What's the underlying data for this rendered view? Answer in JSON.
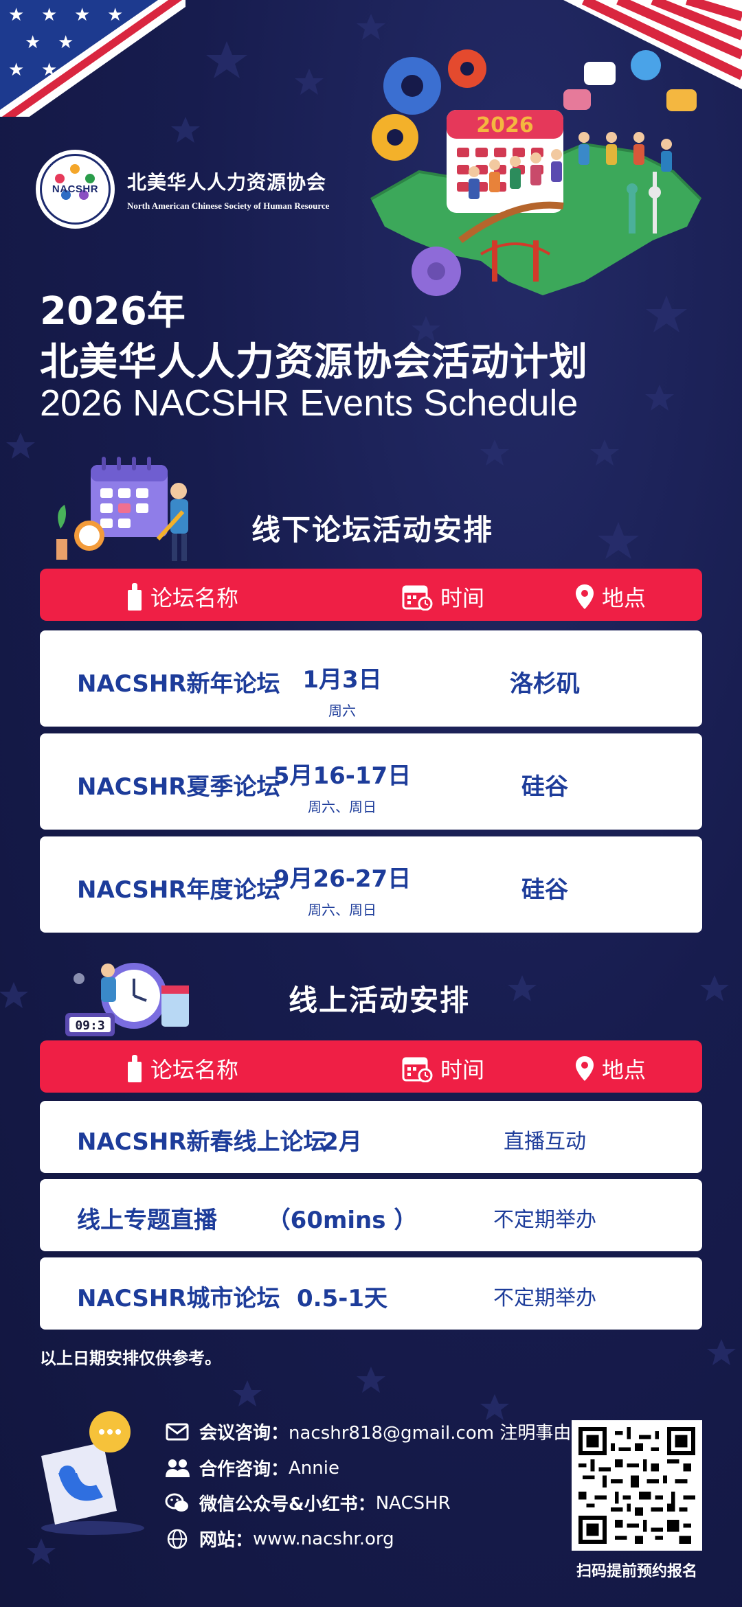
{
  "org": {
    "logo_mark": "NACSHR",
    "name_cn": "北美华人人力资源协会",
    "name_en": "North American Chinese Society of Human Resource"
  },
  "header": {
    "year_title": "2026年",
    "title_cn": "北美华人人力资源协会活动计划",
    "title_en": "2026 NACSHR Events Schedule",
    "hero_calendar_text": "2026"
  },
  "columns": {
    "name": "论坛名称",
    "time": "时间",
    "place": "地点"
  },
  "offline": {
    "title": "线下论坛活动安排",
    "rows": [
      {
        "name": "NACSHR新年论坛",
        "time": "1月3日",
        "day": "周六",
        "place": "洛杉矶"
      },
      {
        "name": "NACSHR夏季论坛",
        "time": "5月16-17日",
        "day": "周六、周日",
        "place": "硅谷"
      },
      {
        "name": "NACSHR年度论坛",
        "time": "9月26-27日",
        "day": "周六、周日",
        "place": "硅谷"
      }
    ]
  },
  "online": {
    "title": "线上活动安排",
    "clock_text": "09:3",
    "rows": [
      {
        "name": "NACSHR新春线上论坛",
        "time": "2月",
        "place": "直播互动"
      },
      {
        "name": "线上专题直播",
        "time": "（60mins ）",
        "place": "不定期举办"
      },
      {
        "name": "NACSHR城市论坛",
        "time": "0.5-1天",
        "place": "不定期举办"
      }
    ]
  },
  "note": "以上日期安排仅供参考。",
  "contacts": [
    {
      "icon": "envelope-icon",
      "label": "会议咨询：",
      "value": "nacshr818@gmail.com 注明事由"
    },
    {
      "icon": "people-icon",
      "label": "合作咨询：",
      "value": "Annie"
    },
    {
      "icon": "wechat-icon",
      "label": "微信公众号&小红书：",
      "value": "NACSHR"
    },
    {
      "icon": "globe-icon",
      "label": "网站：",
      "value": "www.nacshr.org"
    }
  ],
  "qr_caption": "扫码提前预约报名",
  "colors": {
    "background": "#161a4a",
    "accent_red": "#ef1f45",
    "text_blue": "#1d3c9a",
    "row_bg": "#ffffff"
  }
}
